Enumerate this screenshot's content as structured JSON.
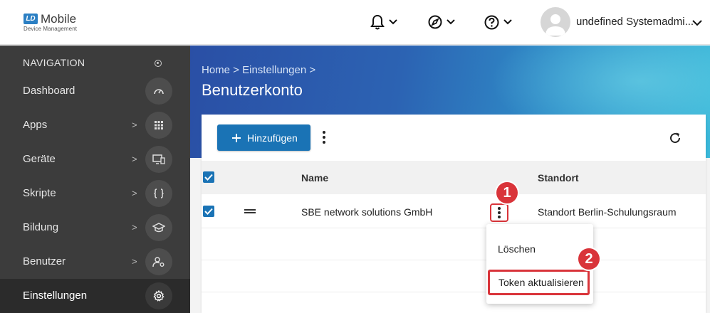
{
  "app": {
    "logo_mark": "LD",
    "logo_title": "Mobile",
    "logo_subtitle": "Device Management"
  },
  "topbar": {
    "icons": [
      "bell-icon",
      "compass-icon",
      "help-icon"
    ],
    "user_name": "undefined Systemadmi..."
  },
  "sidebar": {
    "heading": "NAVIGATION",
    "items": [
      {
        "label": "Dashboard",
        "icon": "gauge-icon",
        "has_children": false
      },
      {
        "label": "Apps",
        "icon": "grid-icon",
        "has_children": true
      },
      {
        "label": "Geräte",
        "icon": "devices-icon",
        "has_children": true
      },
      {
        "label": "Skripte",
        "icon": "braces-icon",
        "has_children": true
      },
      {
        "label": "Bildung",
        "icon": "graduation-cap-icon",
        "has_children": true
      },
      {
        "label": "Benutzer",
        "icon": "user-gear-icon",
        "has_children": true
      },
      {
        "label": "Einstellungen",
        "icon": "gear-icon",
        "has_children": false,
        "active": true
      }
    ],
    "chevron": ">"
  },
  "main": {
    "breadcrumb": "Home > Einstellungen >",
    "title": "Benutzerkonto",
    "add_button": "Hinzufügen",
    "table": {
      "columns": [
        "Name",
        "Standort"
      ],
      "rows": [
        {
          "name": "SBE network solutions GmbH",
          "location": "Standort Berlin-Schulungsraum",
          "checked": true
        }
      ]
    },
    "context_menu": {
      "items": [
        "Löschen",
        "Token aktualisieren"
      ]
    },
    "badges": [
      "1",
      "2"
    ]
  },
  "colors": {
    "primary": "#1a73b5",
    "highlight": "#d9343a",
    "sidebar_bg": "#3c3c3c"
  }
}
